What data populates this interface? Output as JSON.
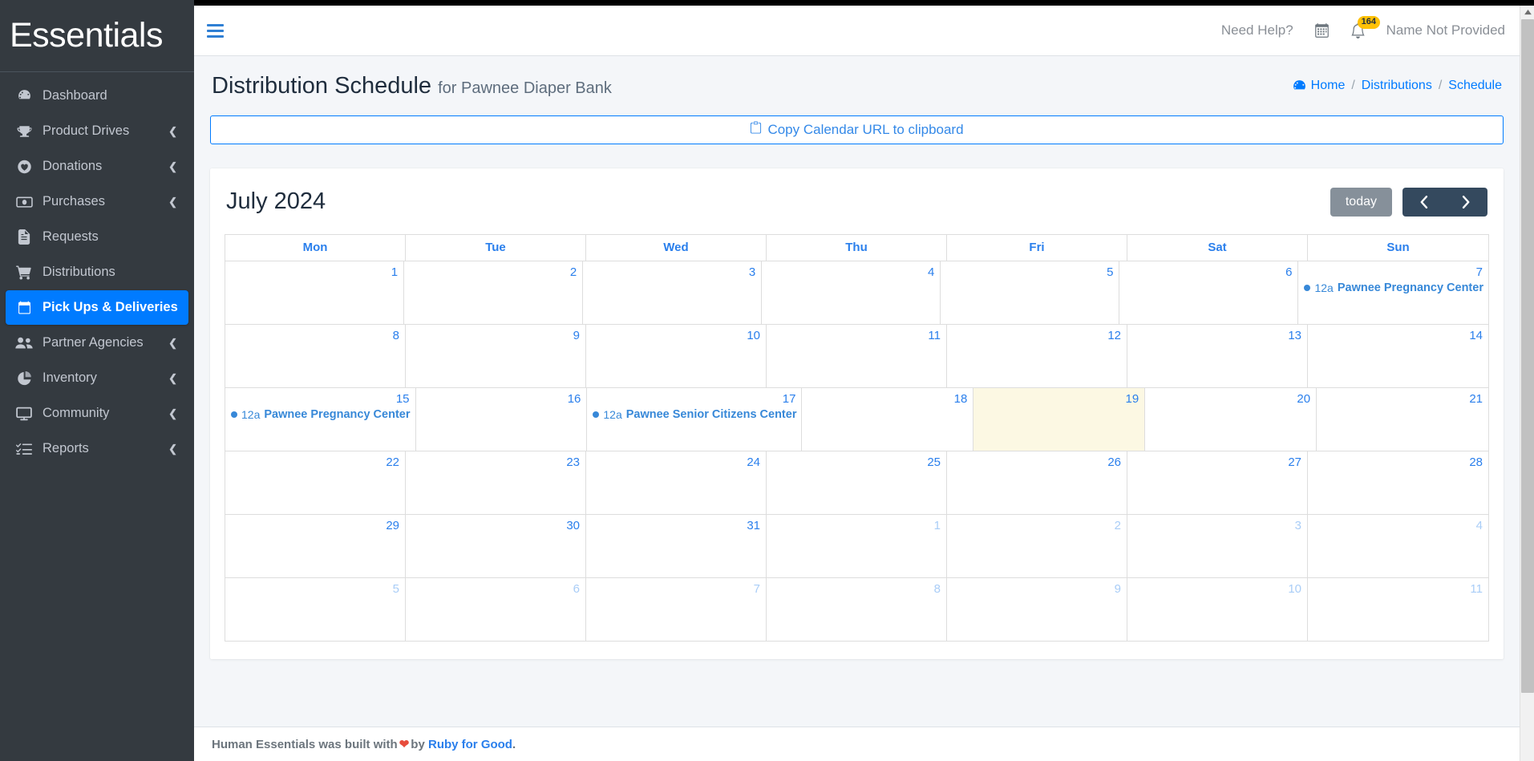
{
  "brand": {
    "name": "Essentials"
  },
  "sidebar": {
    "items": [
      {
        "label": "Dashboard",
        "icon": "dashboard-icon",
        "caret": false,
        "active": false
      },
      {
        "label": "Product Drives",
        "icon": "trophy-icon",
        "caret": true,
        "active": false
      },
      {
        "label": "Donations",
        "icon": "heart-circle-icon",
        "caret": true,
        "active": false
      },
      {
        "label": "Purchases",
        "icon": "money-bill-icon",
        "caret": true,
        "active": false
      },
      {
        "label": "Requests",
        "icon": "file-icon",
        "caret": false,
        "active": false
      },
      {
        "label": "Distributions",
        "icon": "shopping-cart-icon",
        "caret": false,
        "active": false
      },
      {
        "label": "Pick Ups & Deliveries",
        "icon": "calendar-icon",
        "caret": false,
        "active": true
      },
      {
        "label": "Partner Agencies",
        "icon": "users-icon",
        "caret": true,
        "active": false
      },
      {
        "label": "Inventory",
        "icon": "pie-chart-icon",
        "caret": true,
        "active": false
      },
      {
        "label": "Community",
        "icon": "desktop-icon",
        "caret": true,
        "active": false
      },
      {
        "label": "Reports",
        "icon": "tasks-list-icon",
        "caret": true,
        "active": false
      }
    ]
  },
  "navbar": {
    "menu_toggle": "hamburger-icon",
    "need_help": "Need Help?",
    "calendar_icon": "calendar-alt-icon",
    "bell_icon": "bell-icon",
    "notification_count": "164",
    "user_name": "Name Not Provided"
  },
  "page": {
    "title": "Distribution Schedule",
    "subtitle": "for Pawnee Diaper Bank",
    "breadcrumb": [
      {
        "label": "Home",
        "icon": "dashboard-icon"
      },
      {
        "label": "Distributions",
        "icon": null
      },
      {
        "label": "Schedule",
        "icon": null
      }
    ],
    "breadcrumb_separator": "/"
  },
  "copy_bar": {
    "label": "Copy Calendar URL to clipboard",
    "icon": "copy-icon"
  },
  "calendar": {
    "title": "July 2024",
    "today_label": "today",
    "prev_label": "prev-month",
    "next_label": "next-month",
    "day_headers": [
      "Mon",
      "Tue",
      "Wed",
      "Thu",
      "Fri",
      "Sat",
      "Sun"
    ],
    "weeks": [
      [
        {
          "day": "1",
          "other": false,
          "today": false,
          "events": []
        },
        {
          "day": "2",
          "other": false,
          "today": false,
          "events": []
        },
        {
          "day": "3",
          "other": false,
          "today": false,
          "events": []
        },
        {
          "day": "4",
          "other": false,
          "today": false,
          "events": []
        },
        {
          "day": "5",
          "other": false,
          "today": false,
          "events": []
        },
        {
          "day": "6",
          "other": false,
          "today": false,
          "events": []
        },
        {
          "day": "7",
          "other": false,
          "today": false,
          "events": [
            {
              "time": "12a",
              "title": "Pawnee Pregnancy Center"
            }
          ]
        }
      ],
      [
        {
          "day": "8",
          "other": false,
          "today": false,
          "events": []
        },
        {
          "day": "9",
          "other": false,
          "today": false,
          "events": []
        },
        {
          "day": "10",
          "other": false,
          "today": false,
          "events": []
        },
        {
          "day": "11",
          "other": false,
          "today": false,
          "events": []
        },
        {
          "day": "12",
          "other": false,
          "today": false,
          "events": []
        },
        {
          "day": "13",
          "other": false,
          "today": false,
          "events": []
        },
        {
          "day": "14",
          "other": false,
          "today": false,
          "events": []
        }
      ],
      [
        {
          "day": "15",
          "other": false,
          "today": false,
          "events": [
            {
              "time": "12a",
              "title": "Pawnee Pregnancy Center"
            }
          ]
        },
        {
          "day": "16",
          "other": false,
          "today": false,
          "events": []
        },
        {
          "day": "17",
          "other": false,
          "today": false,
          "events": [
            {
              "time": "12a",
              "title": "Pawnee Senior Citizens Center"
            }
          ]
        },
        {
          "day": "18",
          "other": false,
          "today": false,
          "events": []
        },
        {
          "day": "19",
          "other": false,
          "today": true,
          "events": []
        },
        {
          "day": "20",
          "other": false,
          "today": false,
          "events": []
        },
        {
          "day": "21",
          "other": false,
          "today": false,
          "events": []
        }
      ],
      [
        {
          "day": "22",
          "other": false,
          "today": false,
          "events": []
        },
        {
          "day": "23",
          "other": false,
          "today": false,
          "events": []
        },
        {
          "day": "24",
          "other": false,
          "today": false,
          "events": []
        },
        {
          "day": "25",
          "other": false,
          "today": false,
          "events": []
        },
        {
          "day": "26",
          "other": false,
          "today": false,
          "events": []
        },
        {
          "day": "27",
          "other": false,
          "today": false,
          "events": []
        },
        {
          "day": "28",
          "other": false,
          "today": false,
          "events": []
        }
      ],
      [
        {
          "day": "29",
          "other": false,
          "today": false,
          "events": []
        },
        {
          "day": "30",
          "other": false,
          "today": false,
          "events": []
        },
        {
          "day": "31",
          "other": false,
          "today": false,
          "events": []
        },
        {
          "day": "1",
          "other": true,
          "today": false,
          "events": []
        },
        {
          "day": "2",
          "other": true,
          "today": false,
          "events": []
        },
        {
          "day": "3",
          "other": true,
          "today": false,
          "events": []
        },
        {
          "day": "4",
          "other": true,
          "today": false,
          "events": []
        }
      ],
      [
        {
          "day": "5",
          "other": true,
          "today": false,
          "events": []
        },
        {
          "day": "6",
          "other": true,
          "today": false,
          "events": []
        },
        {
          "day": "7",
          "other": true,
          "today": false,
          "events": []
        },
        {
          "day": "8",
          "other": true,
          "today": false,
          "events": []
        },
        {
          "day": "9",
          "other": true,
          "today": false,
          "events": []
        },
        {
          "day": "10",
          "other": true,
          "today": false,
          "events": []
        },
        {
          "day": "11",
          "other": true,
          "today": false,
          "events": []
        }
      ]
    ]
  },
  "footer": {
    "prefix": "Human Essentials was built with",
    "heart": "❤",
    "middle": "by",
    "link": "Ruby for Good",
    "suffix": "."
  },
  "colors": {
    "sidebar_bg": "#343a40",
    "accent_blue": "#007bff",
    "event_blue": "#3788d8",
    "today_highlight": "#fcf8e3",
    "badge_yellow": "#ffc107",
    "nav_button_dark": "#34495e",
    "today_button_gray": "#86909a"
  }
}
